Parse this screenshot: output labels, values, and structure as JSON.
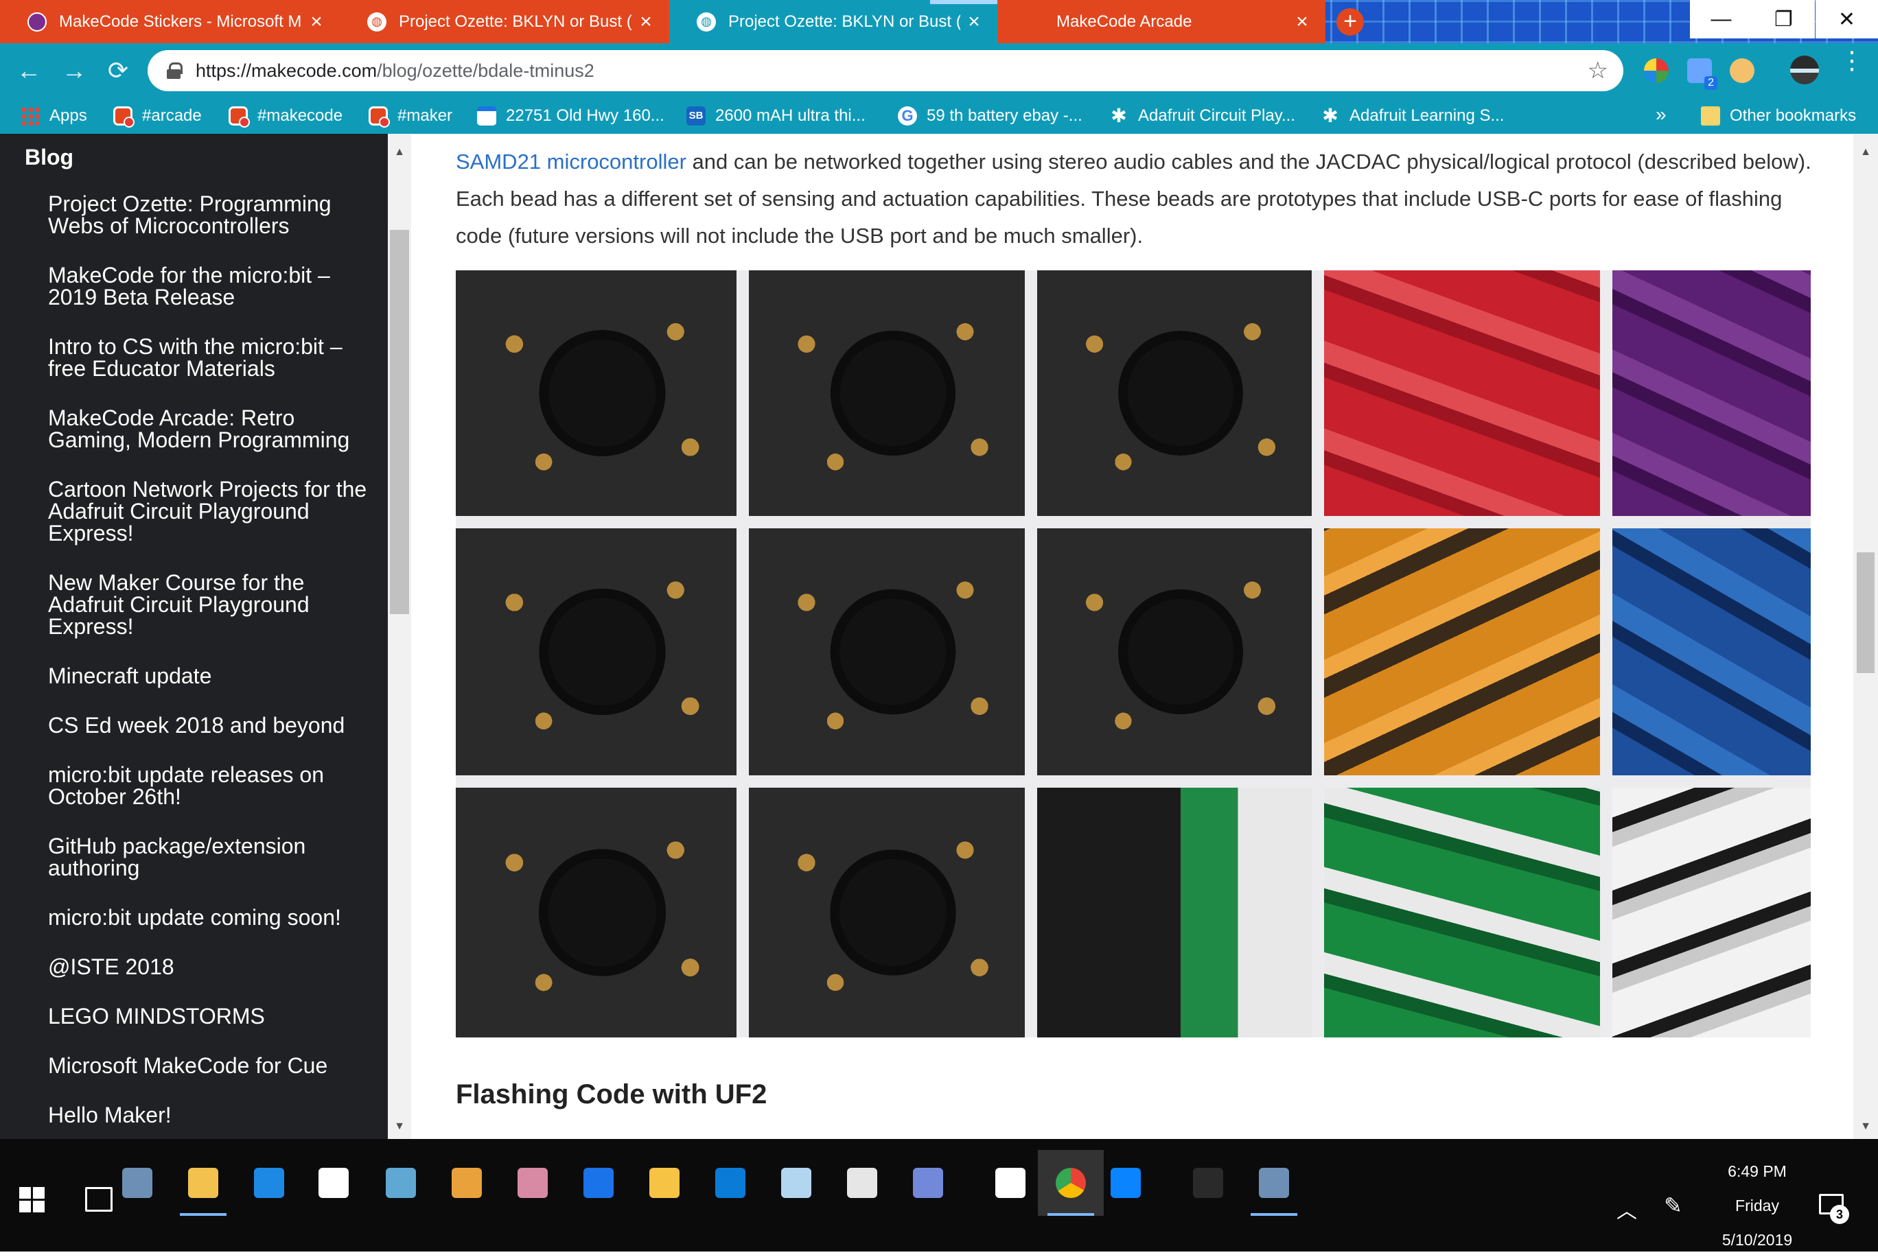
{
  "tabs": [
    {
      "title": "MakeCode Stickers - Microsoft M",
      "favicon": "makecode-purple-icon",
      "active": false
    },
    {
      "title": "Project Ozette: BKLYN or Bust (T",
      "favicon": "globe-icon",
      "active": false
    },
    {
      "title": "Project Ozette: BKLYN or Bust (T",
      "favicon": "globe-icon",
      "active": true
    },
    {
      "title": "MakeCode Arcade",
      "favicon": "makecode-icon",
      "active": false
    }
  ],
  "window_controls": {
    "minimize": "—",
    "maximize": "❐",
    "close": "✕"
  },
  "toolbar": {
    "back": "←",
    "forward": "→",
    "reload": "⟳",
    "url_host": "https://makecode.com",
    "url_path": "/blog/ozette/bdale-tminus2",
    "star": "☆",
    "new_tab": "+",
    "profile_badge": "2",
    "menu": "⋮"
  },
  "bookmarks": [
    {
      "label": "Apps",
      "icon": "apps-grid-icon"
    },
    {
      "label": "#arcade",
      "icon": "makecode-icon"
    },
    {
      "label": "#makecode",
      "icon": "makecode-icon"
    },
    {
      "label": "#maker",
      "icon": "makecode-icon"
    },
    {
      "label": "22751 Old Hwy 160...",
      "icon": "calendar-icon"
    },
    {
      "label": "2600 mAH ultra thi...",
      "icon": "sb-icon"
    },
    {
      "label": "59 th battery ebay -...",
      "icon": "google-icon"
    },
    {
      "label": "Adafruit Circuit Play...",
      "icon": "adafruit-star-icon"
    },
    {
      "label": "Adafruit Learning S...",
      "icon": "adafruit-star-icon"
    }
  ],
  "bookmarks_overflow": "»",
  "other_bookmarks": "Other bookmarks",
  "sidebar": {
    "title": "Blog",
    "items": [
      "Project Ozette: Programming Webs of Microcontrollers",
      "MakeCode for the micro:bit – 2019 Beta Release",
      "Intro to CS with the micro:bit – free Educator Materials",
      "MakeCode Arcade: Retro Gaming, Modern Programming",
      "Cartoon Network Projects for the Adafruit Circuit Playground Express!",
      "New Maker Course for the Adafruit Circuit Playground Express!",
      "Minecraft update",
      "CS Ed week 2018 and beyond",
      "micro:bit update releases on October 26th!",
      "GitHub package/extension authoring",
      "micro:bit update coming soon!",
      "@ISTE 2018",
      "LEGO MINDSTORMS",
      "Microsoft MakeCode for Cue",
      "Hello Maker!"
    ]
  },
  "article": {
    "link_text": "SAMD21 microcontroller",
    "intro_rest": " and can be networked together using stereo audio cables and the JACDAC physical/logical protocol (described below). Each bead has a different set of sensing and actuation capabilities. These beads are prototypes that include USB-C ports for ease of flashing code (future versions will not include the USB port and be much smaller).",
    "section_heading": "Flashing Code with UF2"
  },
  "taskbar": {
    "apps": [
      "file-explorer-app",
      "mail-outlook-app",
      "file-explorer-app",
      "edge-ie-app",
      "mail-app",
      "remote-desktop-app",
      "paint-3d-app",
      "fresh-paint-app",
      "edge-app",
      "sticky-tasks-app",
      "arduino-app",
      "whiteboard-app",
      "terminal-app",
      "discord-app",
      "chrome-app",
      "calculator-app",
      "feedback-app",
      "makecode-arcade-app"
    ],
    "time": "6:49 PM",
    "day": "Friday",
    "date": "5/10/2019",
    "notification_count": "3"
  },
  "colors": {
    "tab_inactive": "#e2461e",
    "tab_active": "#0f9bb8",
    "sidebar_bg": "#202124",
    "link": "#2a6fc9"
  }
}
